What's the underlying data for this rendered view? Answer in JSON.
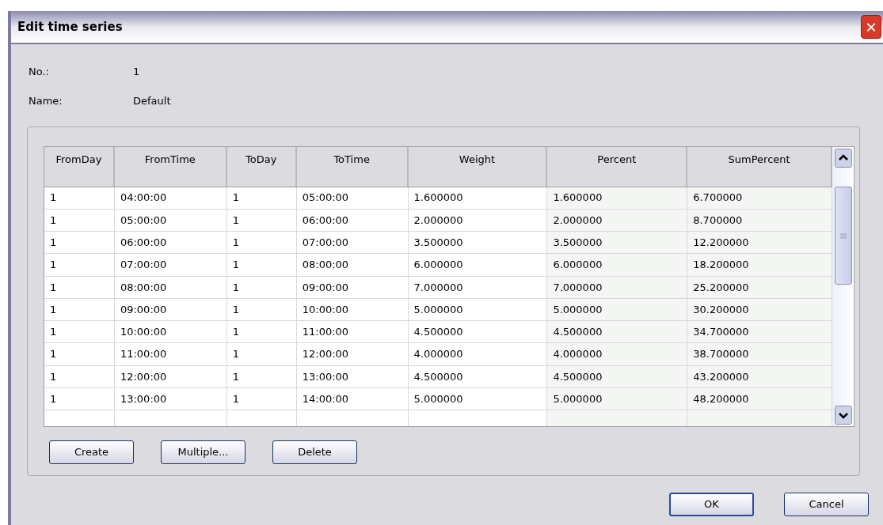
{
  "window": {
    "title": "Edit time series",
    "close": "✕"
  },
  "fields": [
    {
      "label": "No.:",
      "value": "1"
    },
    {
      "label": "Name:",
      "value": "Default"
    }
  ],
  "table": {
    "columns": [
      "FromDay",
      "FromTime",
      "ToDay",
      "ToTime",
      "Weight",
      "Percent",
      "SumPercent"
    ],
    "rows": [
      [
        "1",
        "04:00:00",
        "1",
        "05:00:00",
        "1.600000",
        "1.600000",
        "6.700000"
      ],
      [
        "1",
        "05:00:00",
        "1",
        "06:00:00",
        "2.000000",
        "2.000000",
        "8.700000"
      ],
      [
        "1",
        "06:00:00",
        "1",
        "07:00:00",
        "3.500000",
        "3.500000",
        "12.200000"
      ],
      [
        "1",
        "07:00:00",
        "1",
        "08:00:00",
        "6.000000",
        "6.000000",
        "18.200000"
      ],
      [
        "1",
        "08:00:00",
        "1",
        "09:00:00",
        "7.000000",
        "7.000000",
        "25.200000"
      ],
      [
        "1",
        "09:00:00",
        "1",
        "10:00:00",
        "5.000000",
        "5.000000",
        "30.200000"
      ],
      [
        "1",
        "10:00:00",
        "1",
        "11:00:00",
        "4.500000",
        "4.500000",
        "34.700000"
      ],
      [
        "1",
        "11:00:00",
        "1",
        "12:00:00",
        "4.000000",
        "4.000000",
        "38.700000"
      ],
      [
        "1",
        "12:00:00",
        "1",
        "13:00:00",
        "4.500000",
        "4.500000",
        "43.200000"
      ],
      [
        "1",
        "13:00:00",
        "1",
        "14:00:00",
        "5.000000",
        "5.000000",
        "48.200000"
      ]
    ]
  },
  "table_buttons": [
    "Create",
    "Multiple...",
    "Delete"
  ],
  "dialog_buttons": [
    {
      "label": "OK",
      "default": true
    },
    {
      "label": "Cancel",
      "default": false
    }
  ]
}
